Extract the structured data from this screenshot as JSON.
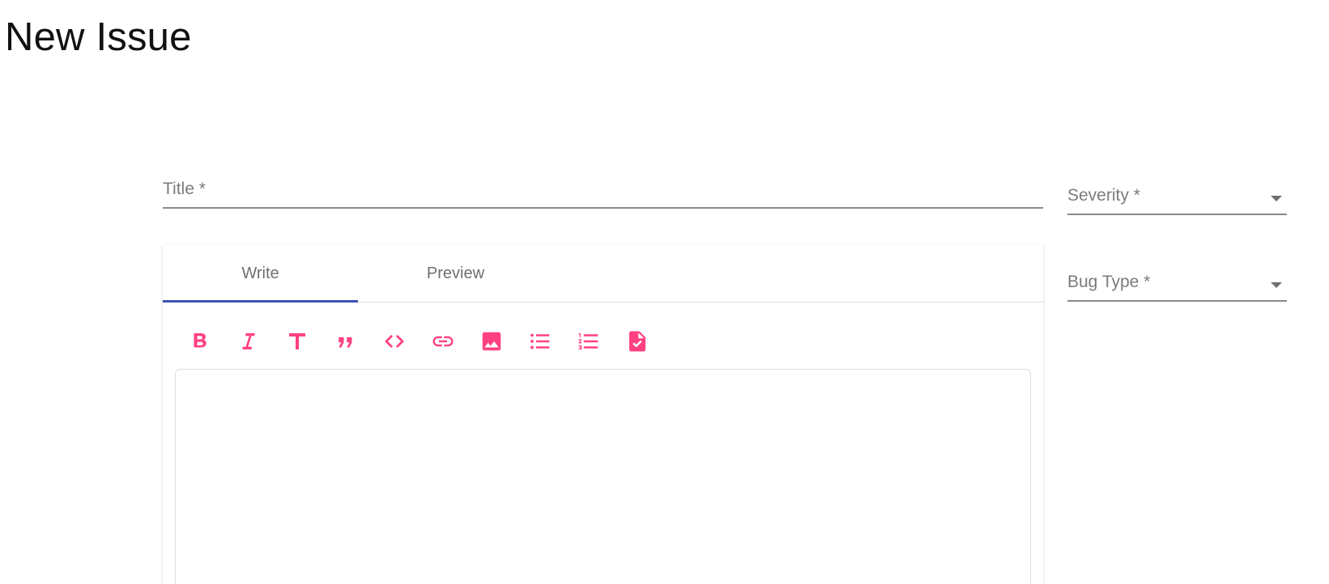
{
  "page": {
    "title": "New Issue"
  },
  "form": {
    "title_field": {
      "label": "Title *",
      "value": ""
    },
    "severity_select": {
      "label": "Severity *",
      "value": ""
    },
    "bug_type_select": {
      "label": "Bug Type *",
      "value": ""
    }
  },
  "editor": {
    "tabs": [
      {
        "label": "Write",
        "active": true
      },
      {
        "label": "Preview",
        "active": false
      }
    ],
    "toolbar": [
      {
        "icon": "bold-icon"
      },
      {
        "icon": "italic-icon"
      },
      {
        "icon": "header-icon"
      },
      {
        "icon": "quote-icon"
      },
      {
        "icon": "code-icon"
      },
      {
        "icon": "link-icon"
      },
      {
        "icon": "image-icon"
      },
      {
        "icon": "unordered-list-icon"
      },
      {
        "icon": "ordered-list-icon"
      },
      {
        "icon": "checked-list-icon"
      }
    ],
    "body_value": ""
  },
  "colors": {
    "accent": "#3f51b5",
    "toolbar_icon": "#ff4081",
    "label": "#7b7b7b",
    "underline": "#8a8a8a"
  }
}
